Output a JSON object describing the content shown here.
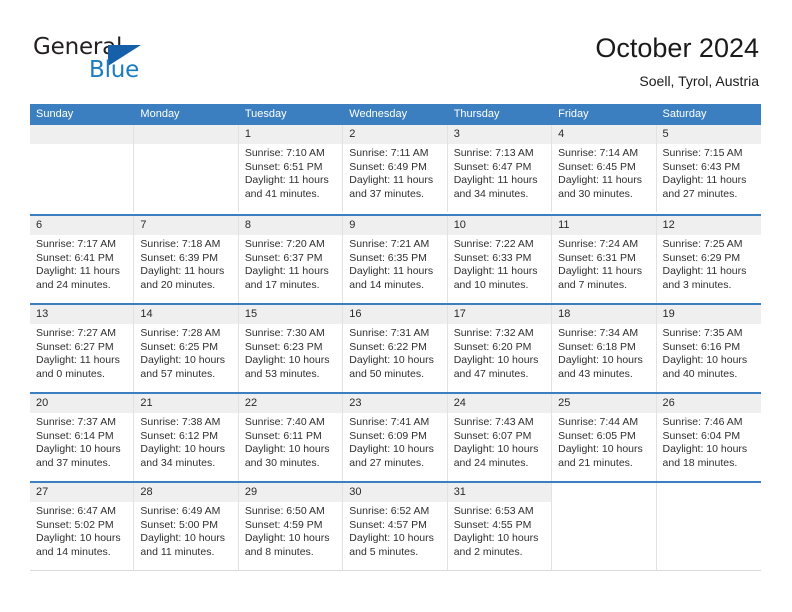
{
  "brand": {
    "name_part1": "General",
    "name_part2": "Blue",
    "accent_color": "#1c7cc0",
    "triangle_color": "#1560a8"
  },
  "header": {
    "title": "October 2024",
    "subtitle": "Soell, Tyrol, Austria"
  },
  "calendar": {
    "header_color": "#3c7fc0",
    "daynum_strip_color": "#efefef",
    "day_names": [
      "Sunday",
      "Monday",
      "Tuesday",
      "Wednesday",
      "Thursday",
      "Friday",
      "Saturday"
    ],
    "weeks": [
      [
        {
          "day": "",
          "sunrise": "",
          "sunset": "",
          "daylight_line1": "",
          "daylight_line2": ""
        },
        {
          "day": "",
          "sunrise": "",
          "sunset": "",
          "daylight_line1": "",
          "daylight_line2": ""
        },
        {
          "day": "1",
          "sunrise": "Sunrise: 7:10 AM",
          "sunset": "Sunset: 6:51 PM",
          "daylight_line1": "Daylight: 11 hours",
          "daylight_line2": "and 41 minutes."
        },
        {
          "day": "2",
          "sunrise": "Sunrise: 7:11 AM",
          "sunset": "Sunset: 6:49 PM",
          "daylight_line1": "Daylight: 11 hours",
          "daylight_line2": "and 37 minutes."
        },
        {
          "day": "3",
          "sunrise": "Sunrise: 7:13 AM",
          "sunset": "Sunset: 6:47 PM",
          "daylight_line1": "Daylight: 11 hours",
          "daylight_line2": "and 34 minutes."
        },
        {
          "day": "4",
          "sunrise": "Sunrise: 7:14 AM",
          "sunset": "Sunset: 6:45 PM",
          "daylight_line1": "Daylight: 11 hours",
          "daylight_line2": "and 30 minutes."
        },
        {
          "day": "5",
          "sunrise": "Sunrise: 7:15 AM",
          "sunset": "Sunset: 6:43 PM",
          "daylight_line1": "Daylight: 11 hours",
          "daylight_line2": "and 27 minutes."
        }
      ],
      [
        {
          "day": "6",
          "sunrise": "Sunrise: 7:17 AM",
          "sunset": "Sunset: 6:41 PM",
          "daylight_line1": "Daylight: 11 hours",
          "daylight_line2": "and 24 minutes."
        },
        {
          "day": "7",
          "sunrise": "Sunrise: 7:18 AM",
          "sunset": "Sunset: 6:39 PM",
          "daylight_line1": "Daylight: 11 hours",
          "daylight_line2": "and 20 minutes."
        },
        {
          "day": "8",
          "sunrise": "Sunrise: 7:20 AM",
          "sunset": "Sunset: 6:37 PM",
          "daylight_line1": "Daylight: 11 hours",
          "daylight_line2": "and 17 minutes."
        },
        {
          "day": "9",
          "sunrise": "Sunrise: 7:21 AM",
          "sunset": "Sunset: 6:35 PM",
          "daylight_line1": "Daylight: 11 hours",
          "daylight_line2": "and 14 minutes."
        },
        {
          "day": "10",
          "sunrise": "Sunrise: 7:22 AM",
          "sunset": "Sunset: 6:33 PM",
          "daylight_line1": "Daylight: 11 hours",
          "daylight_line2": "and 10 minutes."
        },
        {
          "day": "11",
          "sunrise": "Sunrise: 7:24 AM",
          "sunset": "Sunset: 6:31 PM",
          "daylight_line1": "Daylight: 11 hours",
          "daylight_line2": "and 7 minutes."
        },
        {
          "day": "12",
          "sunrise": "Sunrise: 7:25 AM",
          "sunset": "Sunset: 6:29 PM",
          "daylight_line1": "Daylight: 11 hours",
          "daylight_line2": "and 3 minutes."
        }
      ],
      [
        {
          "day": "13",
          "sunrise": "Sunrise: 7:27 AM",
          "sunset": "Sunset: 6:27 PM",
          "daylight_line1": "Daylight: 11 hours",
          "daylight_line2": "and 0 minutes."
        },
        {
          "day": "14",
          "sunrise": "Sunrise: 7:28 AM",
          "sunset": "Sunset: 6:25 PM",
          "daylight_line1": "Daylight: 10 hours",
          "daylight_line2": "and 57 minutes."
        },
        {
          "day": "15",
          "sunrise": "Sunrise: 7:30 AM",
          "sunset": "Sunset: 6:23 PM",
          "daylight_line1": "Daylight: 10 hours",
          "daylight_line2": "and 53 minutes."
        },
        {
          "day": "16",
          "sunrise": "Sunrise: 7:31 AM",
          "sunset": "Sunset: 6:22 PM",
          "daylight_line1": "Daylight: 10 hours",
          "daylight_line2": "and 50 minutes."
        },
        {
          "day": "17",
          "sunrise": "Sunrise: 7:32 AM",
          "sunset": "Sunset: 6:20 PM",
          "daylight_line1": "Daylight: 10 hours",
          "daylight_line2": "and 47 minutes."
        },
        {
          "day": "18",
          "sunrise": "Sunrise: 7:34 AM",
          "sunset": "Sunset: 6:18 PM",
          "daylight_line1": "Daylight: 10 hours",
          "daylight_line2": "and 43 minutes."
        },
        {
          "day": "19",
          "sunrise": "Sunrise: 7:35 AM",
          "sunset": "Sunset: 6:16 PM",
          "daylight_line1": "Daylight: 10 hours",
          "daylight_line2": "and 40 minutes."
        }
      ],
      [
        {
          "day": "20",
          "sunrise": "Sunrise: 7:37 AM",
          "sunset": "Sunset: 6:14 PM",
          "daylight_line1": "Daylight: 10 hours",
          "daylight_line2": "and 37 minutes."
        },
        {
          "day": "21",
          "sunrise": "Sunrise: 7:38 AM",
          "sunset": "Sunset: 6:12 PM",
          "daylight_line1": "Daylight: 10 hours",
          "daylight_line2": "and 34 minutes."
        },
        {
          "day": "22",
          "sunrise": "Sunrise: 7:40 AM",
          "sunset": "Sunset: 6:11 PM",
          "daylight_line1": "Daylight: 10 hours",
          "daylight_line2": "and 30 minutes."
        },
        {
          "day": "23",
          "sunrise": "Sunrise: 7:41 AM",
          "sunset": "Sunset: 6:09 PM",
          "daylight_line1": "Daylight: 10 hours",
          "daylight_line2": "and 27 minutes."
        },
        {
          "day": "24",
          "sunrise": "Sunrise: 7:43 AM",
          "sunset": "Sunset: 6:07 PM",
          "daylight_line1": "Daylight: 10 hours",
          "daylight_line2": "and 24 minutes."
        },
        {
          "day": "25",
          "sunrise": "Sunrise: 7:44 AM",
          "sunset": "Sunset: 6:05 PM",
          "daylight_line1": "Daylight: 10 hours",
          "daylight_line2": "and 21 minutes."
        },
        {
          "day": "26",
          "sunrise": "Sunrise: 7:46 AM",
          "sunset": "Sunset: 6:04 PM",
          "daylight_line1": "Daylight: 10 hours",
          "daylight_line2": "and 18 minutes."
        }
      ],
      [
        {
          "day": "27",
          "sunrise": "Sunrise: 6:47 AM",
          "sunset": "Sunset: 5:02 PM",
          "daylight_line1": "Daylight: 10 hours",
          "daylight_line2": "and 14 minutes."
        },
        {
          "day": "28",
          "sunrise": "Sunrise: 6:49 AM",
          "sunset": "Sunset: 5:00 PM",
          "daylight_line1": "Daylight: 10 hours",
          "daylight_line2": "and 11 minutes."
        },
        {
          "day": "29",
          "sunrise": "Sunrise: 6:50 AM",
          "sunset": "Sunset: 4:59 PM",
          "daylight_line1": "Daylight: 10 hours",
          "daylight_line2": "and 8 minutes."
        },
        {
          "day": "30",
          "sunrise": "Sunrise: 6:52 AM",
          "sunset": "Sunset: 4:57 PM",
          "daylight_line1": "Daylight: 10 hours",
          "daylight_line2": "and 5 minutes."
        },
        {
          "day": "31",
          "sunrise": "Sunrise: 6:53 AM",
          "sunset": "Sunset: 4:55 PM",
          "daylight_line1": "Daylight: 10 hours",
          "daylight_line2": "and 2 minutes."
        },
        {
          "day": "",
          "sunrise": "",
          "sunset": "",
          "daylight_line1": "",
          "daylight_line2": ""
        },
        {
          "day": "",
          "sunrise": "",
          "sunset": "",
          "daylight_line1": "",
          "daylight_line2": ""
        }
      ]
    ]
  }
}
